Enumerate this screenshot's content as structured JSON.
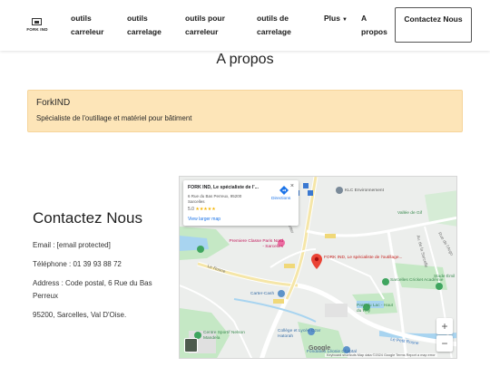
{
  "header": {
    "logo_text": "FORK IND",
    "nav_items": [
      {
        "label": "outils carreleur"
      },
      {
        "label": "outils carrelage"
      },
      {
        "label": "outils pour carreleur"
      },
      {
        "label": "outils de carrelage"
      },
      {
        "label": "Plus"
      },
      {
        "label": "A propos"
      }
    ],
    "contact_button": "Contactez Nous"
  },
  "page": {
    "title": "A propos"
  },
  "notice": {
    "title": "ForkIND",
    "subtitle": "Spécialiste de l'outillage et matériel pour bâtiment"
  },
  "contact": {
    "title": "Contactez Nous",
    "email": "Email : [email protected]",
    "phone": "Téléphone : 01 39 93 88 72",
    "address": "Address : Code postal, 6 Rue du Bas Perreux",
    "city": "95200, Sarcelles, Val D'Oise."
  },
  "map": {
    "card_name": "FORK IND, Le spécialiste de l'...",
    "card_address": "6 Rue du Bas Perreux, 95200 Sarcelles",
    "card_rating": "5.0",
    "card_stars": "★★★★★",
    "card_view_large": "View larger map",
    "card_directions": "Directions",
    "marker_label": "FORK IND, Le spécialiste de l'outillage...",
    "places": [
      "KLC Environnement",
      "Vallée de Gif",
      "Premiere Classe Paris Nord - Sarcelles",
      "Carter-Cash",
      "Sarcelles Cricket Académie",
      "Stade Émil",
      "Parc du Lac - Haut du Roy",
      "Le Petit Rosne",
      "Centre Sportif Nelson Mandela",
      "Collège et Lycée Ozar Hatorah",
      "Fondation Léonie Chaptal",
      "Rue de l'Argo",
      "Av. de la Sarcelle",
      "Le Rosne",
      "Quartier"
    ],
    "zoom_in": "+",
    "zoom_out": "−",
    "google": "Google",
    "attribution": "Keyboard shortcuts   Map data ©2024 Google   Terms   Report a map error"
  },
  "colors": {
    "notice_bg": "#fde5b8",
    "accent": "#1a73e8",
    "marker": "#ea4335",
    "park": "#c5e8c5",
    "water": "#a8d4f0"
  }
}
